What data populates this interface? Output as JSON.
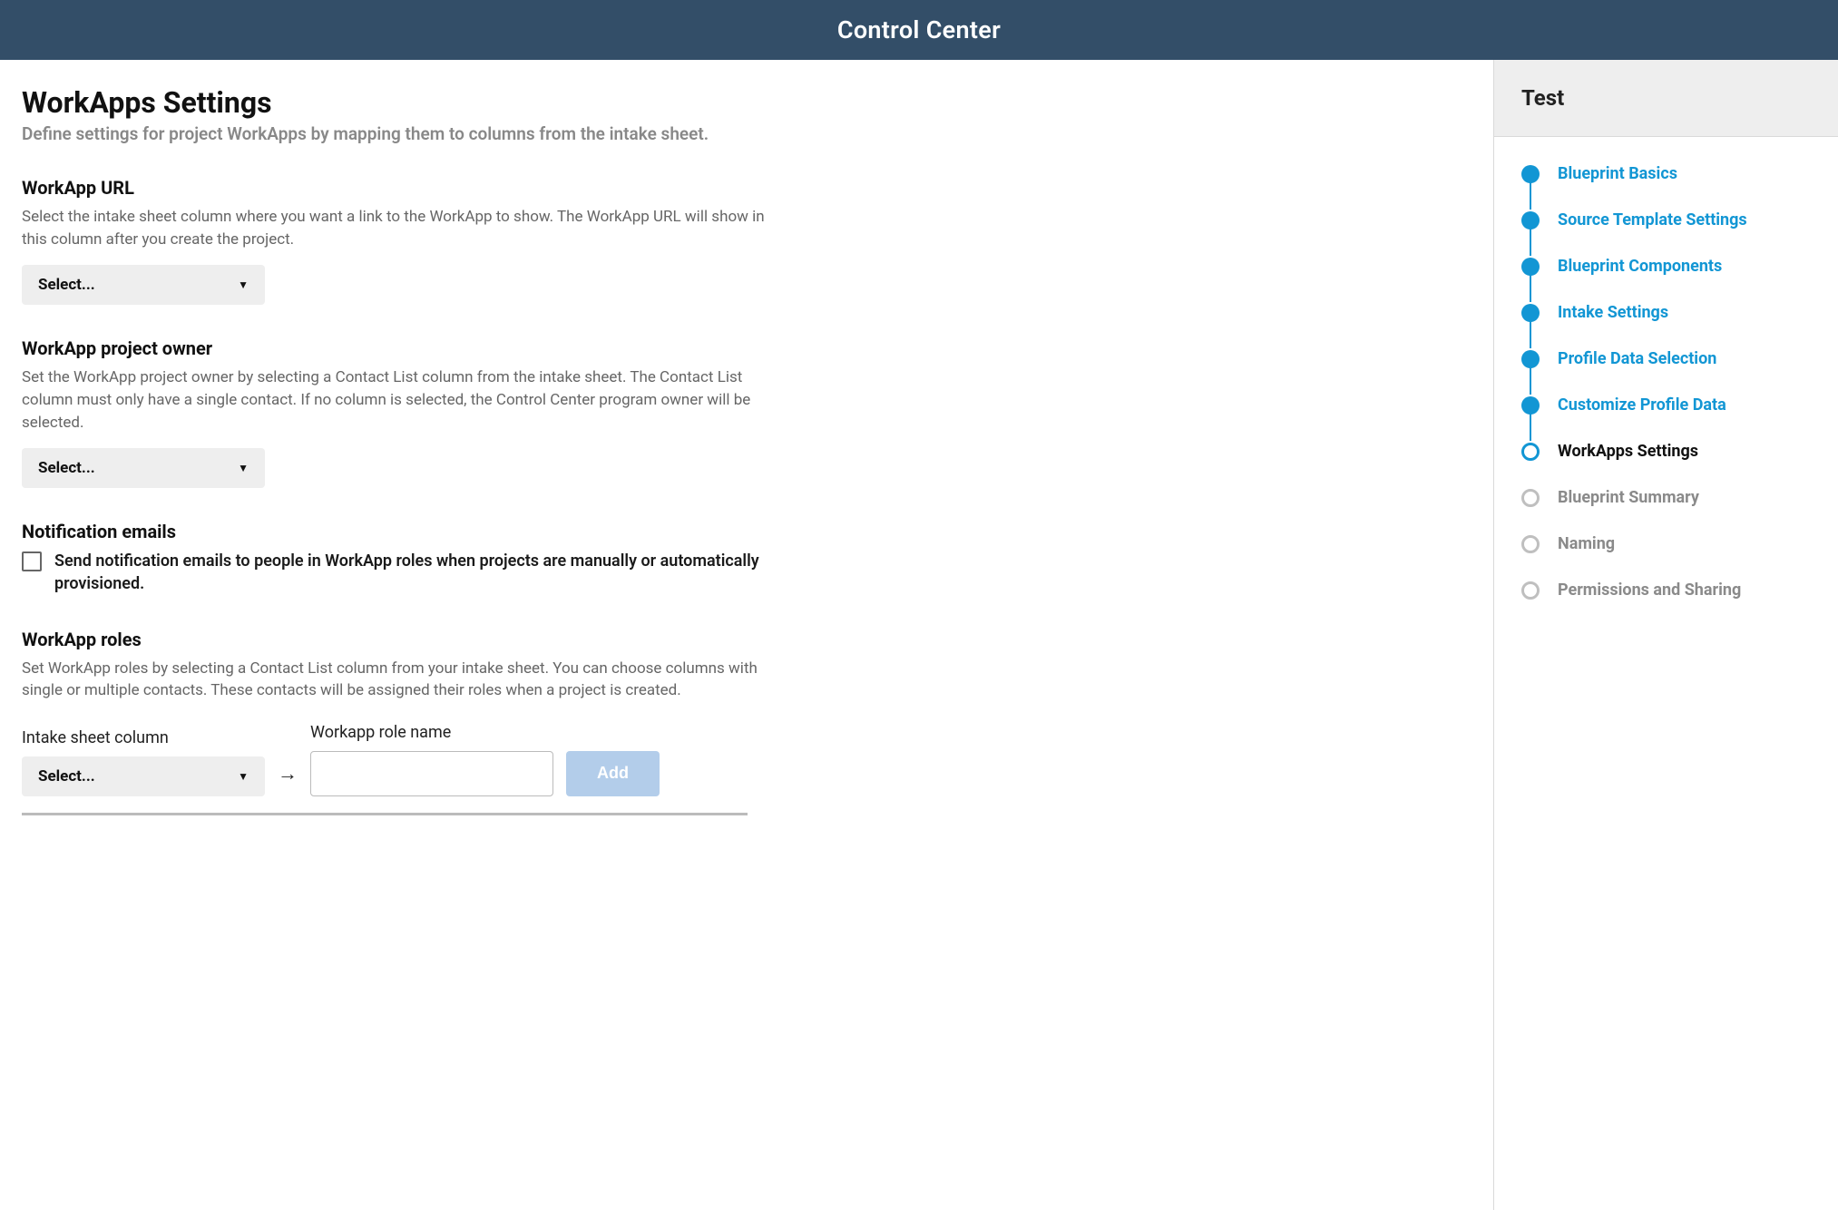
{
  "topbar": {
    "title": "Control Center"
  },
  "page": {
    "title": "WorkApps Settings",
    "subtitle": "Define settings for project WorkApps by mapping them to columns from the intake sheet."
  },
  "sections": {
    "url": {
      "heading": "WorkApp URL",
      "desc": "Select the intake sheet column where you want a link to the WorkApp to show. The WorkApp URL will show in this column after you create the project.",
      "select_label": "Select..."
    },
    "owner": {
      "heading": "WorkApp project owner",
      "desc": "Set the WorkApp project owner by selecting a Contact List column from the intake sheet. The Contact List column must only have a single contact. If no column is selected, the Control Center program owner will be selected.",
      "select_label": "Select..."
    },
    "notifications": {
      "heading": "Notification emails",
      "checkbox_label": "Send notification emails to people in WorkApp roles when projects are manually or automatically provisioned."
    },
    "roles": {
      "heading": "WorkApp roles",
      "desc": "Set WorkApp roles by selecting a Contact List column from your intake sheet. You can choose columns with single or multiple contacts. These contacts will be assigned their roles when a project is created.",
      "col1_label": "Intake sheet column",
      "col2_label": "Workapp role name",
      "select_label": "Select...",
      "add_label": "Add"
    }
  },
  "sidebar": {
    "title": "Test",
    "steps": [
      {
        "label": "Blueprint Basics",
        "state": "done"
      },
      {
        "label": "Source Template Settings",
        "state": "done"
      },
      {
        "label": "Blueprint Components",
        "state": "done"
      },
      {
        "label": "Intake Settings",
        "state": "done"
      },
      {
        "label": "Profile Data Selection",
        "state": "done"
      },
      {
        "label": "Customize Profile Data",
        "state": "done"
      },
      {
        "label": "WorkApps Settings",
        "state": "current"
      },
      {
        "label": "Blueprint Summary",
        "state": "pending"
      },
      {
        "label": "Naming",
        "state": "pending"
      },
      {
        "label": "Permissions and Sharing",
        "state": "pending"
      }
    ]
  }
}
